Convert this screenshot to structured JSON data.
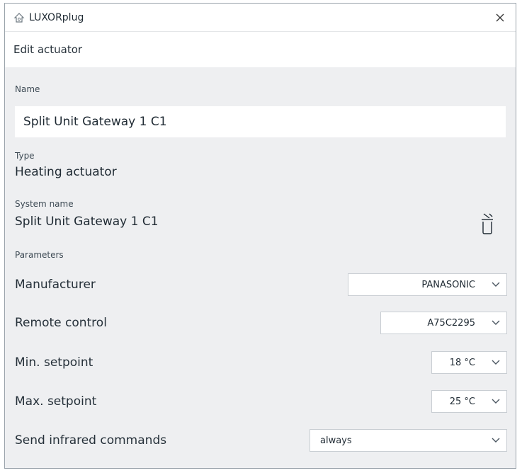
{
  "window": {
    "title": "LUXORplug",
    "subtitle": "Edit actuator"
  },
  "name_field": {
    "label": "Name",
    "value": "Split Unit Gateway 1 C1"
  },
  "type_field": {
    "label": "Type",
    "value": "Heating actuator"
  },
  "system_name_field": {
    "label": "System name",
    "value": "Split Unit Gateway 1 C1"
  },
  "parameters": {
    "heading": "Parameters",
    "rows": [
      {
        "label": "Manufacturer",
        "value": "PANASONIC"
      },
      {
        "label": "Remote control",
        "value": "A75C2295"
      },
      {
        "label": "Min. setpoint",
        "value": "18 °C"
      },
      {
        "label": "Max. setpoint",
        "value": "25 °C"
      },
      {
        "label": "Send infrared commands",
        "value": "always"
      }
    ]
  },
  "icons": {
    "app": "luxor-app-icon",
    "close": "close-icon",
    "delete": "trash-icon",
    "dropdown": "chevron-down-icon"
  },
  "colors": {
    "background": "#eeeff1",
    "panel": "#ffffff",
    "border": "#c9ced3"
  }
}
